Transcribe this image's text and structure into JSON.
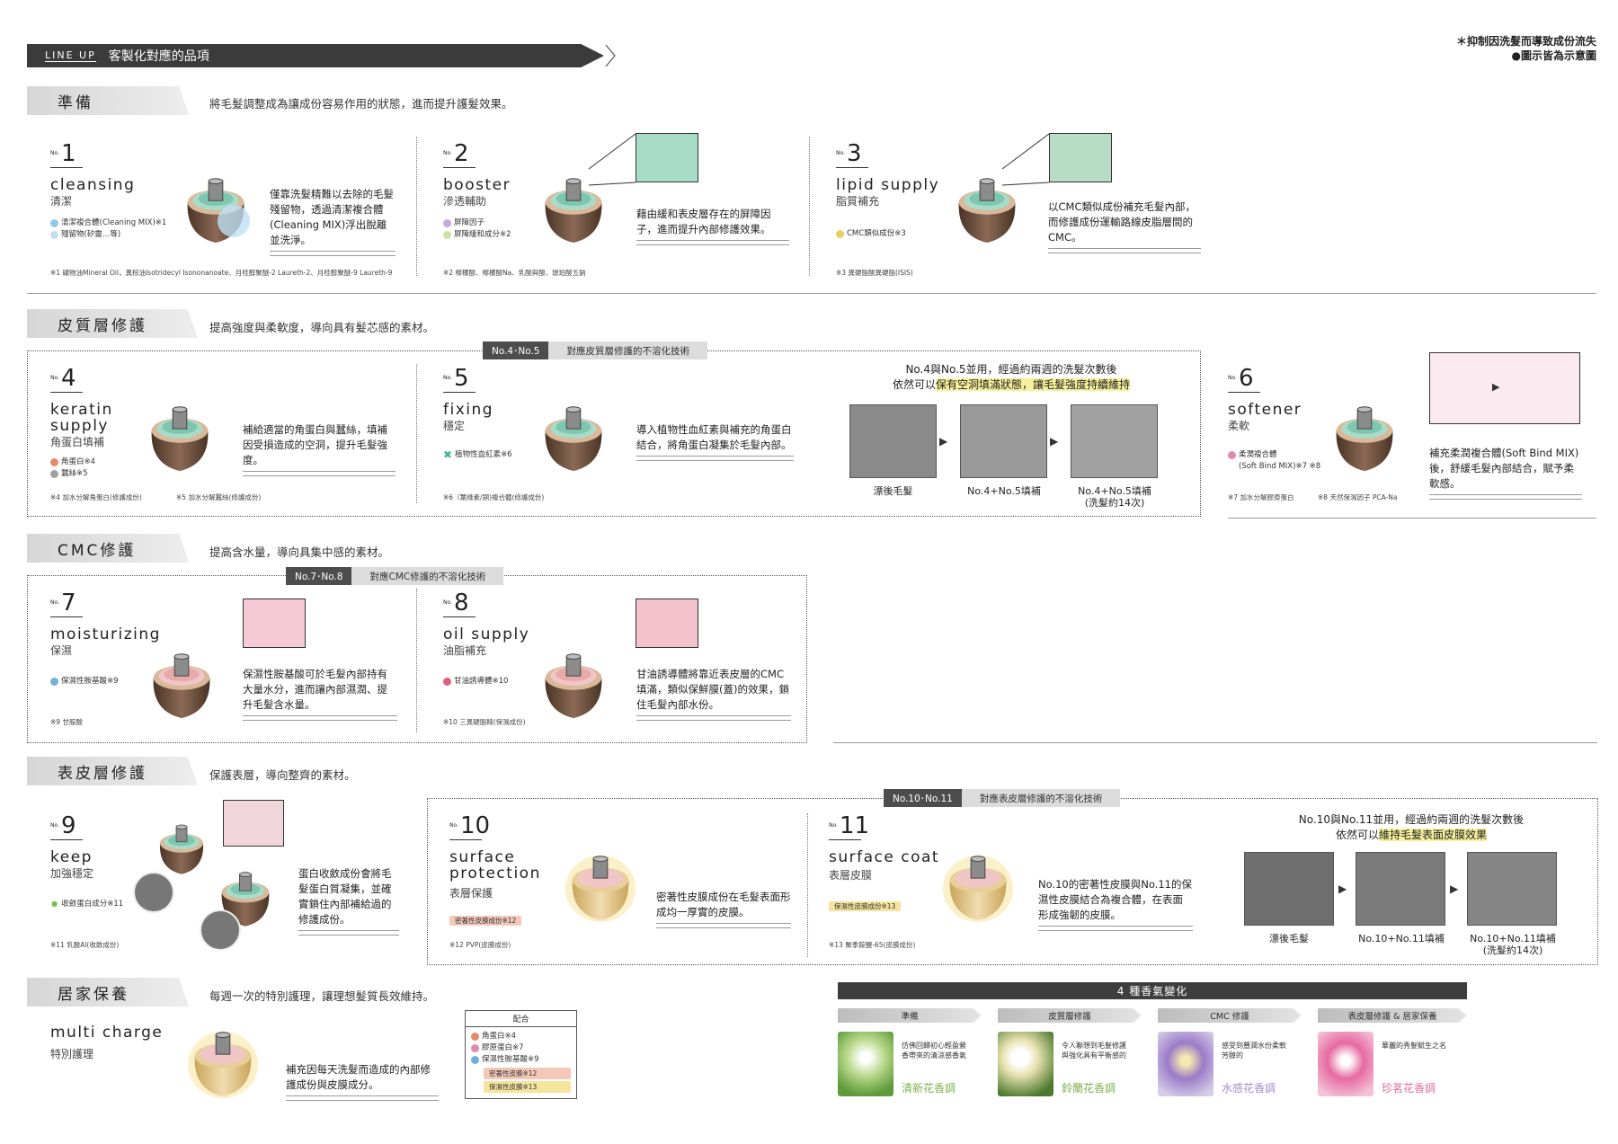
{
  "banner": {
    "lineup": "LINE UP",
    "title": "客製化對應的品項"
  },
  "topnote": {
    "line1": "＊抑制因洗髮而導致成份流失",
    "line2": "●圖示皆為示意圖"
  },
  "sections": {
    "prep": {
      "title": "準備",
      "desc": "將毛髮調整成為讓成份容易作用的狀態，進而提升護髮效果。"
    },
    "cortex": {
      "title": "皮質層修護",
      "desc": "提高強度與柔軟度，導向具有髮芯感的素材。"
    },
    "cmc": {
      "title": "CMC修護",
      "desc": "提高含水量，導向具集中感的素材。"
    },
    "cuticle": {
      "title": "表皮層修護",
      "desc": "保護表層，導向整齊的素材。"
    },
    "home": {
      "title": "居家保養",
      "desc": "每週一次的特別護理，讓理想髮質長效維持。"
    }
  },
  "tags": {
    "t45": {
      "no": "No.4･No.5",
      "label": "對應皮質層修護的不溶化技術"
    },
    "t78": {
      "no": "No.7･No.8",
      "label": "對應CMC修護的不溶化技術"
    },
    "t1011": {
      "no": "No.10･No.11",
      "label": "對應表皮層修護的不溶化技術"
    }
  },
  "products": {
    "p1": {
      "no": "1",
      "en": "cleansing",
      "zh": "清潔",
      "desc": "僅靠洗髮精難以去除的毛髮殘留物，透過清潔複合體(Cleaning MIX)浮出脫離並洗淨。",
      "ing1": "清潔複合體(Cleaning MIX)※1",
      "ing2": "殘留物(矽靈…等)",
      "fn": "※1 礦物油Mineral Oil，異棕油Isotridecyl Isononanoate、月桂醇聚醚-2 Laureth-2、月桂醇聚醚-9 Laureth-9"
    },
    "p2": {
      "no": "2",
      "en": "booster",
      "zh": "滲透輔助",
      "desc": "藉由緩和表皮層存在的屏障因子，進而提升內部修護效果。",
      "ing1": "屏障因子",
      "ing2": "屏障緩和成分※2",
      "fn": "※2 檸檬酸、檸檬酸Na、乳酸與酸、琥珀酸五鈉"
    },
    "p3": {
      "no": "3",
      "en": "lipid supply",
      "zh": "脂質補充",
      "desc": "以CMC類似成份補充毛髮內部，而修護成份運輸路線皮脂層間的CMC。",
      "ing1": "CMC類似成份※3",
      "fn": "※3 異硬脂酸異硬脂(ISIS)"
    },
    "p4": {
      "no": "4",
      "en": "keratin supply",
      "zh": "角蛋白填補",
      "desc": "補給適當的角蛋白與蠶絲，填補因受損造成的空洞，提升毛髮強度。",
      "ing1": "角蛋白※4",
      "ing2": "蠶絲※5",
      "fn1": "※4 加水分解角蛋白(修護成份)",
      "fn2": "※5 加水分解蠶絲(修護成份)"
    },
    "p5": {
      "no": "5",
      "en": "fixing",
      "zh": "穩定",
      "desc": "導入植物性血紅素與補充的角蛋白結合，將角蛋白凝集於毛髮內部。",
      "ing1": "植物性血紅素※6",
      "fn": "※6（葉綠素/銅)複合體(修護成份)"
    },
    "p6": {
      "no": "6",
      "en": "softener",
      "zh": "柔軟",
      "desc": "補充柔潤複合體(Soft Bind MIX)後，舒緩毛髮內部結合，賦予柔軟感。",
      "ing1": "柔潤複合體",
      "ing2": "(Soft Bind MIX)※7 ※8",
      "fn1": "※7 加水分解膠原蛋白",
      "fn2": "※8 天然保濕因子 PCA-Na"
    },
    "p7": {
      "no": "7",
      "en": "moisturizing",
      "zh": "保濕",
      "desc": "保濕性胺基酸可於毛髮內部持有大量水分，進而讓內部濕潤、提升毛髮含水量。",
      "ing1": "保濕性胺基酸※9",
      "fn": "※9 甘胺酸"
    },
    "p8": {
      "no": "8",
      "en": "oil supply",
      "zh": "油脂補充",
      "desc": "甘油誘導體將靠近表皮層的CMC填滿，類似保鮮膜(蓋)的效果，鎖住毛髮內部水份。",
      "ing1": "甘油誘導體※10",
      "fn": "※10 三異硬脂精(保濕成份)"
    },
    "p9": {
      "no": "9",
      "en": "keep",
      "zh": "加強穩定",
      "desc": "蛋白收斂成份會將毛髮蛋白質凝集，並確實鎖住內部補給過的修護成份。",
      "ing1": "收斂蛋白成分※11",
      "fn": "※11 乳酸Al(收斂成份)"
    },
    "p10": {
      "no": "10",
      "en": "surface protection",
      "zh": "表層保護",
      "desc": "密著性皮膜成份在毛髮表面形成均一厚實的皮膜。",
      "ing1": "密著性皮膜成份※12",
      "fn": "※12 PVP(皮膜成份)"
    },
    "p11": {
      "no": "11",
      "en": "surface coat",
      "zh": "表層皮膜",
      "desc": "No.10的密著性皮膜與No.11的保濕性皮膜結合為複合體，在表面形成強韌的皮膜。",
      "ing1": "保濕性皮膜成份※13",
      "fn": "※13 聚季銨鹽-65(皮膜成份)"
    },
    "mc": {
      "en": "multi charge",
      "zh": "特別護理",
      "desc": "補充因每天洗髮而造成的內部修護成份與皮膜成分。"
    }
  },
  "compare45": {
    "line1": "No.4與No.5並用，經過約兩週的洗髮次數後",
    "pre": "依然可以",
    "hl": "保有空洞填滿狀態，讓毛髮強度持續維持",
    "labels": [
      "漂後毛髮",
      "No.4+No.5填補",
      "No.4+No.5填補",
      "(洗髮約14次)"
    ]
  },
  "compare1011": {
    "line1": "No.10與No.11並用，經過約兩週的洗髮次數後",
    "pre": "依然可以",
    "hl": "維持毛髮表面皮膜效果",
    "labels": [
      "漂後毛髮",
      "No.10+No.11填補",
      "No.10+No.11填補",
      "(洗髮約14次)"
    ]
  },
  "mix": {
    "title": "配合",
    "rows": [
      "角蛋白※4",
      "膠原蛋白※7",
      "保濕性胺基酸※9",
      "密著性皮膜※12",
      "保濕性皮膜※13"
    ]
  },
  "scents": {
    "title": "4 種香氣變化",
    "items": [
      {
        "cat": "準備",
        "desc": "仿佛回歸初心輕盈縈香帶來的清涼感香氣",
        "name": "清新花香調",
        "color": "#7bb24d"
      },
      {
        "cat": "皮質層修護",
        "desc": "令人聯想到毛髮修護與強化具有平衡感的",
        "name": "鈴蘭花香調",
        "color": "#7bb24d"
      },
      {
        "cat": "CMC 修護",
        "desc": "感受到豐潤水份柔軟芳醇的",
        "name": "水感花香調",
        "color": "#a58ac9"
      },
      {
        "cat": "表皮層修護 & 居家保養",
        "desc": "華麗的秀髮賦生之名",
        "name": "珍茗花香調",
        "color": "#d96fa0"
      }
    ]
  }
}
